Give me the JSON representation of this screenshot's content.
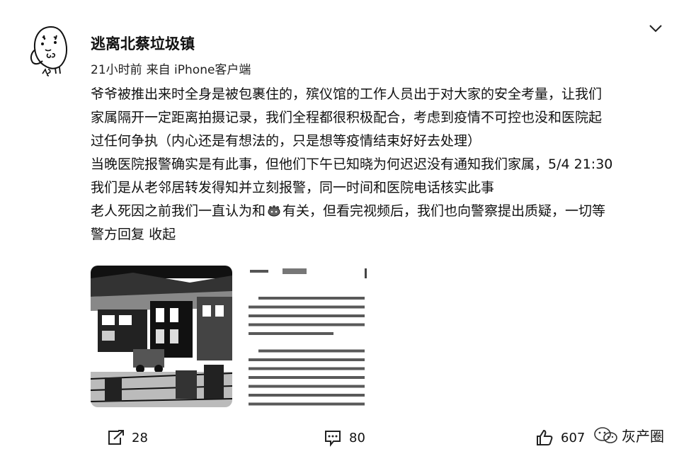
{
  "post": {
    "username": "逃离北蔡垃圾镇",
    "time": "21小时前",
    "source": "来自 iPhone客户端",
    "lines": [
      "爷爷被推出来时全身是被包裹住的，殡仪馆的工作人员出于对大家的安全考量，让我们",
      "家属隔开一定距离拍摄记录，我们全程都很积极配合，考虑到疫情不可控也没和医院起",
      "过任何争执（内心还是有想法的，只是想等疫情结束好好去处理）",
      "当晚医院报警确实是有此事，但他们下午已知晓为何迟迟没有通知我们家属，5/4 21:30",
      "我们是从老邻居转发得知并立刻报警，同一时间和医院电话核实此事"
    ],
    "line6_before": "老人死因之前我们一直认为和",
    "line6_after": "有关，但看完视频后，我们也向警察提出质疑，一切等",
    "line7": "警方回复",
    "collapse_label": "收起",
    "emoji_icon": "virus-emoji-icon"
  },
  "actions": {
    "repost_count": "28",
    "comment_count": "80",
    "like_count": "607"
  },
  "watermark": {
    "text": "灰产圈"
  }
}
